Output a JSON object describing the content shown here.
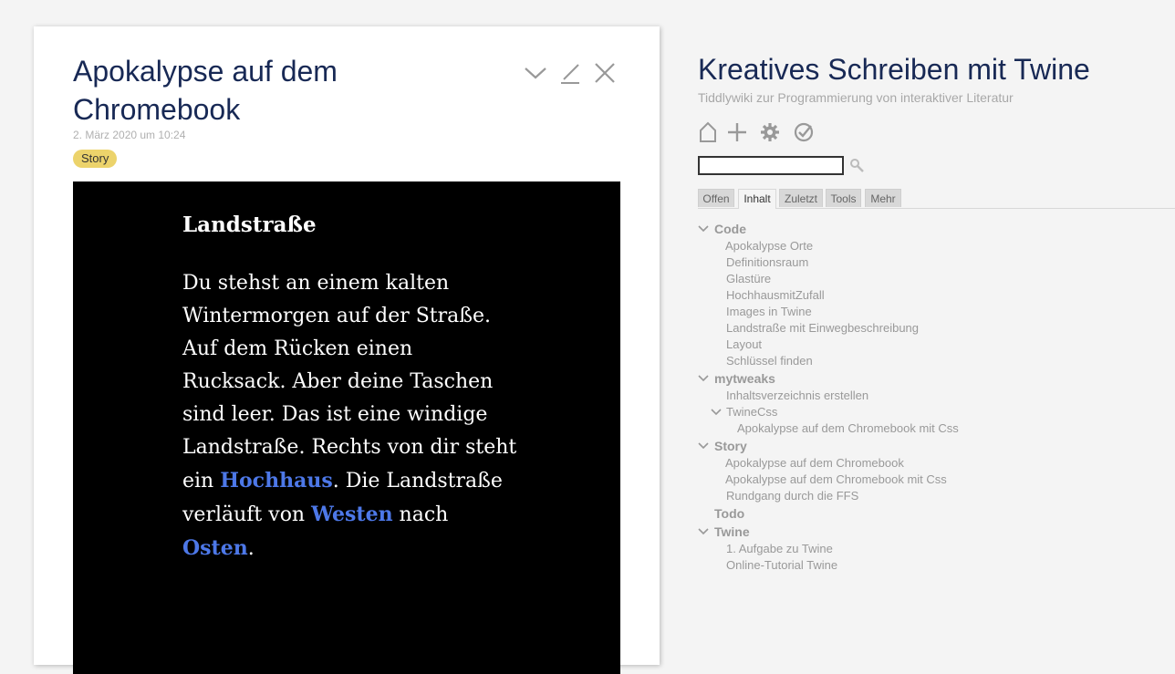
{
  "tiddler": {
    "title": "Apokalypse auf dem Chromebook",
    "date": "2. März 2020 um 10:24",
    "tag": "Story",
    "controls": [
      "chevron-down-icon",
      "edit-pencil-icon",
      "close-icon"
    ]
  },
  "passage": {
    "title": "Landstraße",
    "text_1": "Du stehst an einem kalten Wintermorgen auf der Straße. Auf dem Rücken einen Rucksack. Aber deine Taschen sind leer. Das ist eine windige Landstraße. Rechts von dir steht ein ",
    "link_1": "Hochhaus",
    "text_2": ". Die Landstraße verläuft von ",
    "link_2": "Westen",
    "text_3": " nach ",
    "link_3": "Osten",
    "text_4": ".",
    "link_color": "#4d78e8",
    "background": "#000000"
  },
  "sidebar": {
    "title": "Kreatives Schreiben mit Twine",
    "subtitle": "Tiddlywiki zur Programmierung von interaktiver Literatur",
    "toolbar": [
      "home-icon",
      "plus-icon",
      "gear-icon",
      "checkmark-circle-icon"
    ],
    "search": {
      "value": "",
      "icon": "search-icon"
    },
    "tabs": [
      {
        "label": "Offen",
        "active": false
      },
      {
        "label": "Inhalt",
        "active": true
      },
      {
        "label": "Zuletzt",
        "active": false
      },
      {
        "label": "Tools",
        "active": false
      },
      {
        "label": "Mehr",
        "active": false
      }
    ],
    "toc": [
      {
        "label": "Code",
        "group": true,
        "expanded": true,
        "level": 0
      },
      {
        "label": "Apokalypse Orte",
        "level": 1
      },
      {
        "label": "Definitionsraum",
        "level": 1
      },
      {
        "label": "Glastüre",
        "level": 1
      },
      {
        "label": "HochhausmitZufall",
        "level": 1
      },
      {
        "label": "Images in Twine",
        "level": 1
      },
      {
        "label": "Landstraße mit Einwegbeschreibung",
        "level": 1
      },
      {
        "label": "Layout",
        "level": 1
      },
      {
        "label": "Schlüssel finden",
        "level": 1
      },
      {
        "label": "mytweaks",
        "group": true,
        "expanded": true,
        "level": 0
      },
      {
        "label": "Inhaltsverzeichnis erstellen",
        "level": 1
      },
      {
        "label": "TwineCss",
        "level": 1,
        "expanded": true
      },
      {
        "label": "Apokalypse auf dem Chromebook mit Css",
        "level": 2
      },
      {
        "label": "Story",
        "group": true,
        "expanded": true,
        "level": 0
      },
      {
        "label": "Apokalypse auf dem Chromebook",
        "level": 1
      },
      {
        "label": "Apokalypse auf dem Chromebook mit Css",
        "level": 1
      },
      {
        "label": "Rundgang durch die FFS",
        "level": 1
      },
      {
        "label": "Todo",
        "group": true,
        "expanded": false,
        "level": 0
      },
      {
        "label": "Twine",
        "group": true,
        "expanded": true,
        "level": 0
      },
      {
        "label": "1. Aufgabe zu Twine",
        "level": 1
      },
      {
        "label": "Online-Tutorial Twine",
        "level": 1
      }
    ]
  }
}
